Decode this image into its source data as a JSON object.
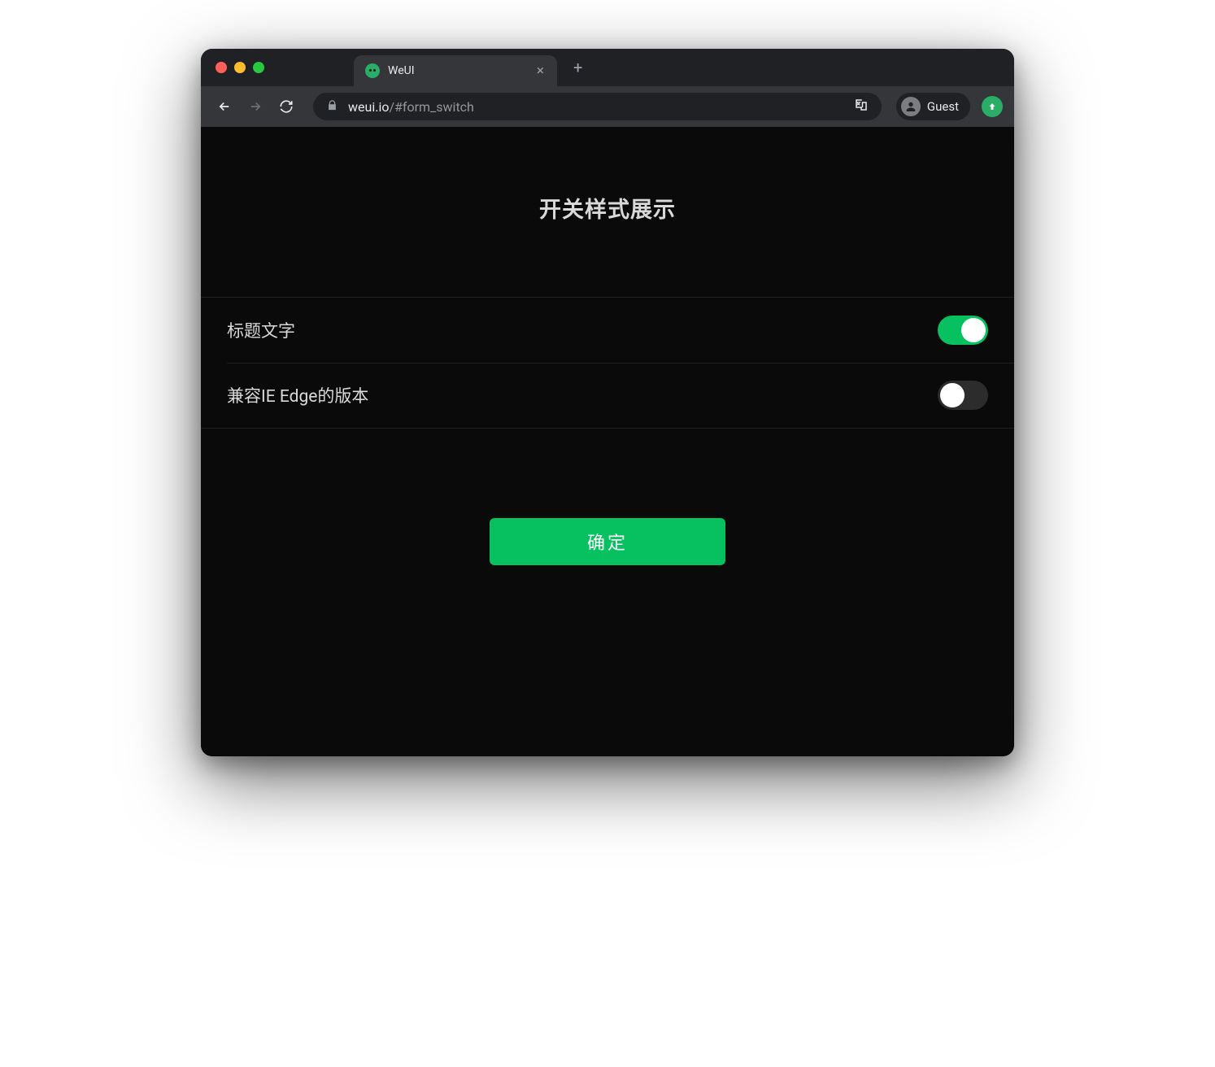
{
  "browser": {
    "tab_title": "WeUI",
    "url_host": "weui.io",
    "url_path": "/#form_switch",
    "profile_label": "Guest"
  },
  "page": {
    "title": "开关样式展示",
    "switches": [
      {
        "label": "标题文字",
        "on": true
      },
      {
        "label": "兼容IE Edge的版本",
        "on": false
      }
    ],
    "submit_label": "确定"
  },
  "colors": {
    "accent": "#07c160",
    "bg": "#0a0a0a"
  }
}
